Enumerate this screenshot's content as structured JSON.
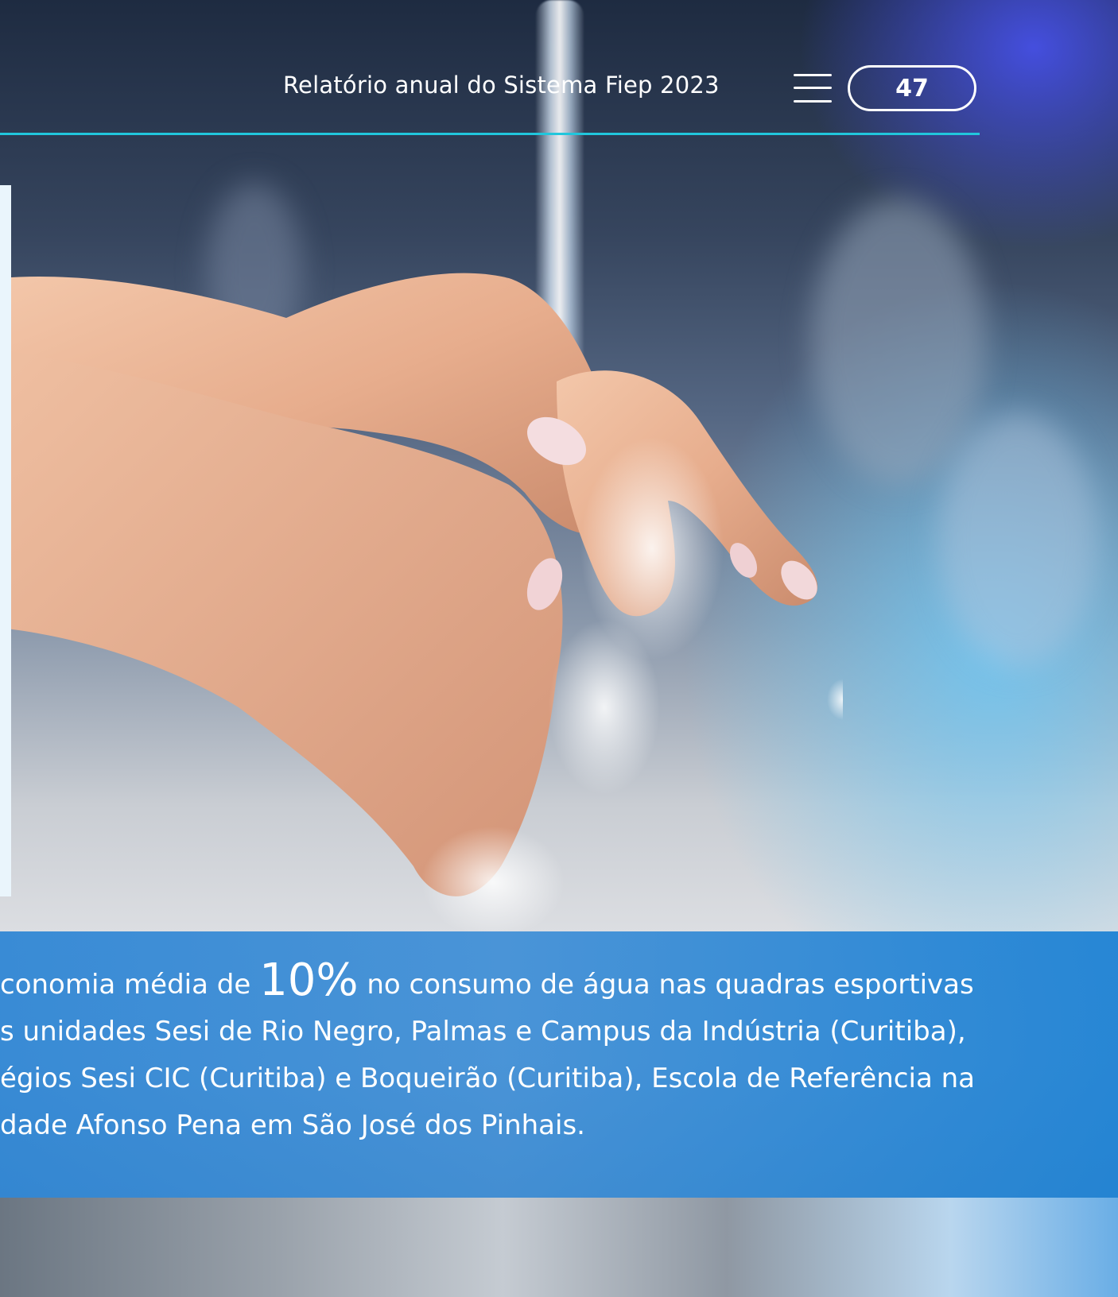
{
  "header": {
    "title": "Relatório anual do Sistema Fiep 2023",
    "page_number": "47",
    "menu_icon": "hamburger-menu-icon"
  },
  "caption": {
    "line1_pre": "conomia média de ",
    "line1_highlight": "10%",
    "line1_post": " no consumo de água nas quadras esportivas",
    "line2": "s unidades Sesi de Rio Negro, Palmas e Campus da Indústria (Curitiba),",
    "line3": "égios Sesi CIC (Curitiba) e Boqueirão (Curitiba), Escola de Referência na",
    "line4": "dade Afonso Pena em São José dos Pinhais."
  },
  "colors": {
    "accent_rule": "#21c6dc",
    "caption_bg": "#2b84d4",
    "text": "#ffffff"
  },
  "photo": {
    "subject": "hands-washing-under-water-image"
  }
}
